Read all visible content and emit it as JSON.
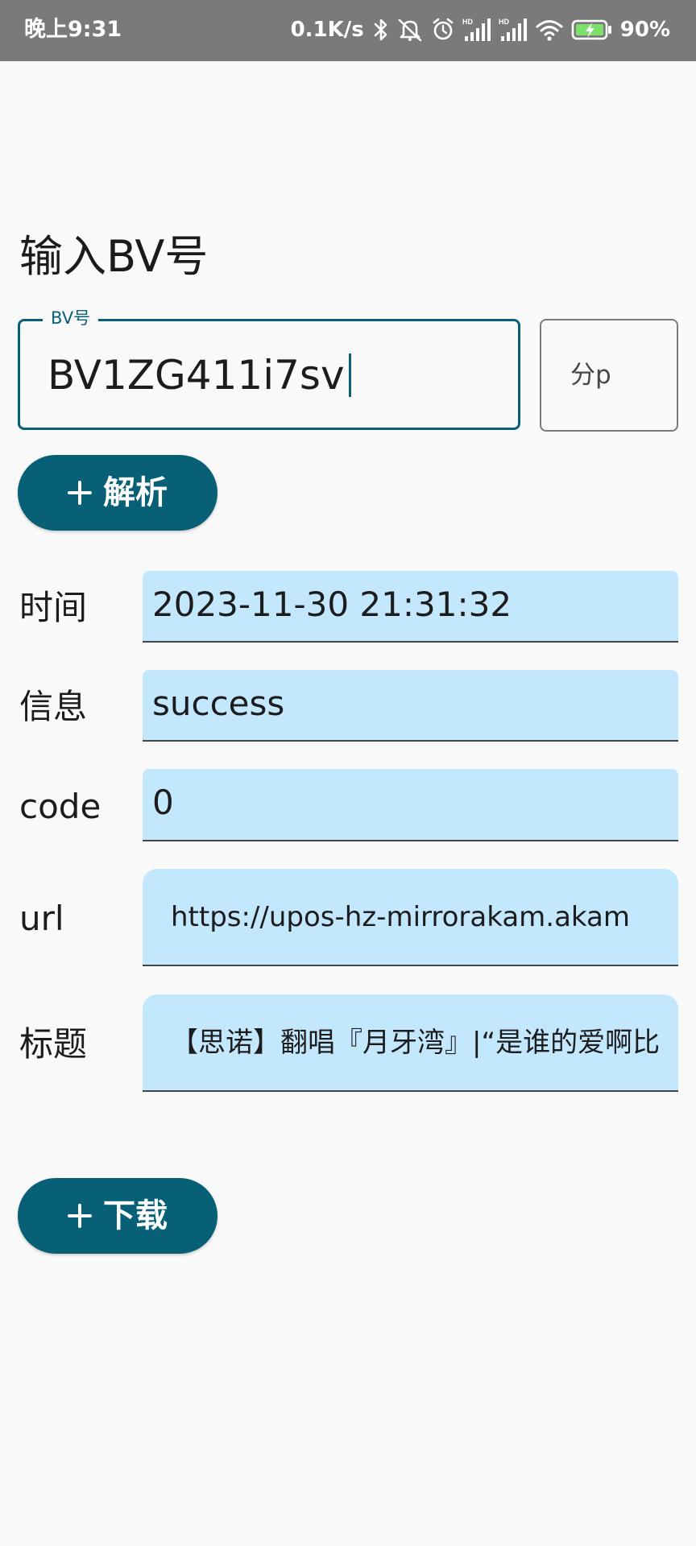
{
  "status_bar": {
    "time": "晚上9:31",
    "net_speed": "0.1K/s",
    "hd_badge": "HD",
    "battery_percent": "90%",
    "icons": [
      "bluetooth-icon",
      "mute-icon",
      "alarm-icon",
      "signal-hd-icon",
      "signal-hd-icon",
      "wifi-icon",
      "battery-charging-icon"
    ]
  },
  "page": {
    "title": "输入BV号"
  },
  "bv_input": {
    "label": "BV号",
    "value": "BV1ZG411i7sv"
  },
  "part_input": {
    "placeholder": "分p"
  },
  "buttons": {
    "parse_label": "解析",
    "download_label": "下载",
    "icon": "plus-icon"
  },
  "results": {
    "time": {
      "label": "时间",
      "value": "2023-11-30 21:31:32"
    },
    "info": {
      "label": "信息",
      "value": "success"
    },
    "code": {
      "label": "code",
      "value": "0"
    },
    "url": {
      "label": "url",
      "value": "https://upos-hz-mirrorakam.akam"
    },
    "title": {
      "label": "标题",
      "value": "【思诺】翻唱『月牙湾』|“是谁的爱啊比"
    }
  },
  "colors": {
    "primary": "#086077",
    "field_fill": "#c3e8fe",
    "status_bar": "#7a7a7a",
    "background": "#f9f9f9",
    "battery_charge": "#7ee06a"
  }
}
